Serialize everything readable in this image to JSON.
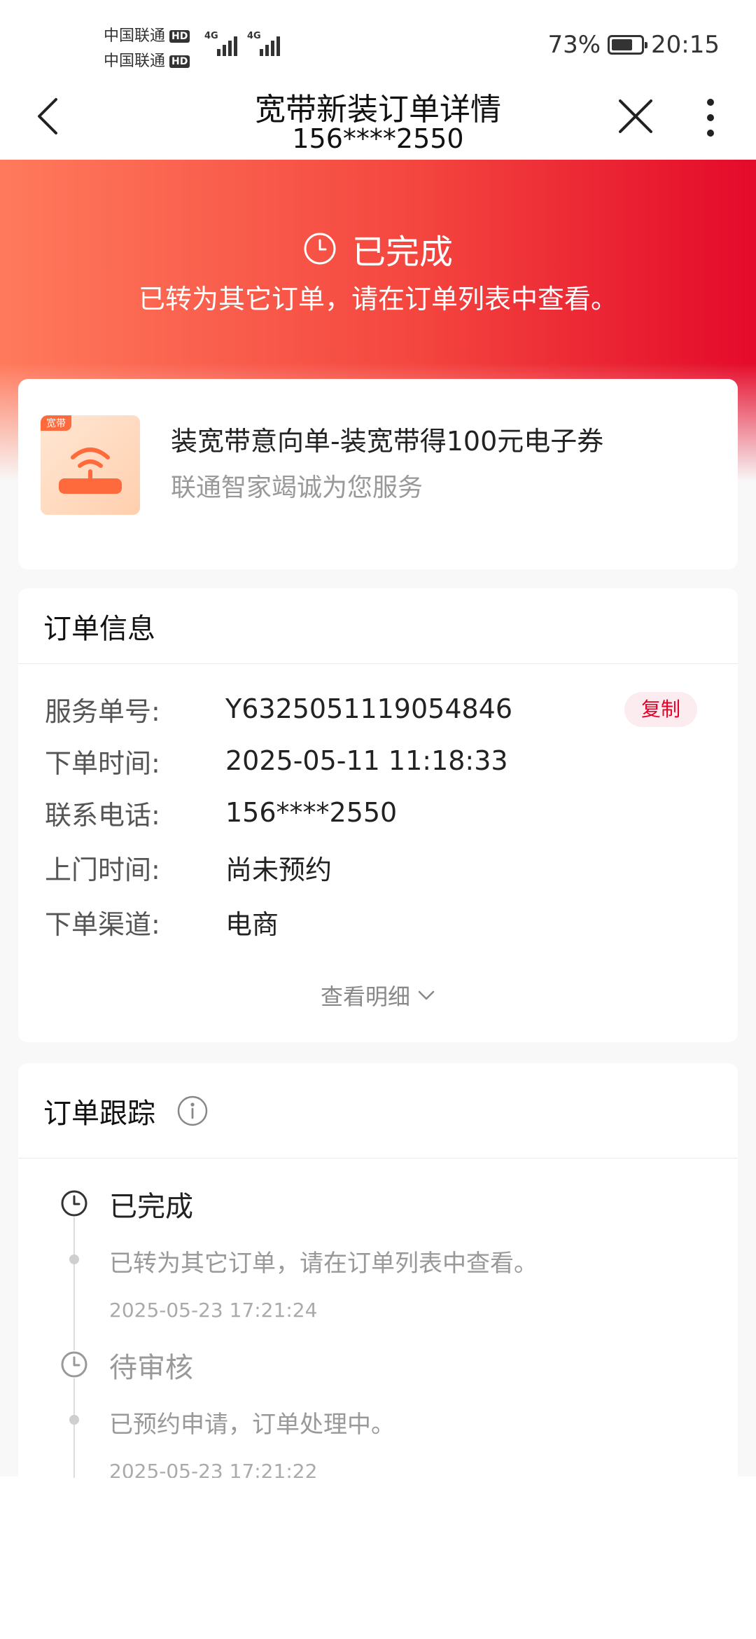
{
  "status_bar": {
    "carrier1": "中国联通",
    "carrier2": "中国联通",
    "hd_label": "HD",
    "net_label": "4G",
    "battery_percent": "73%",
    "battery_level": 0.73,
    "time": "20:15"
  },
  "nav": {
    "title": "宽带新装订单详情",
    "subtitle": "156****2550",
    "back_icon": "chevron-left-icon",
    "close_icon": "close-icon",
    "more_icon": "more-vertical-icon"
  },
  "hero": {
    "status": "已完成",
    "description": "已转为其它订单，请在订单列表中查看。",
    "icon": "clock-icon"
  },
  "product": {
    "tag": "宽带",
    "title": "装宽带意向单-装宽带得100元电子券",
    "subtitle": "联通智家竭诚为您服务",
    "icon": "router-icon"
  },
  "order_info": {
    "heading": "订单信息",
    "rows": [
      {
        "label": "服务单号:",
        "value": "Y6325051119054846"
      },
      {
        "label": "下单时间:",
        "value": "2025-05-11 11:18:33"
      },
      {
        "label": "联系电话:",
        "value": "156****2550"
      },
      {
        "label": "上门时间:",
        "value": "尚未预约"
      },
      {
        "label": "下单渠道:",
        "value": "电商"
      }
    ],
    "copy_label": "复制",
    "detail_link": "查看明细"
  },
  "tracking": {
    "heading": "订单跟踪",
    "events": [
      {
        "status": "已完成",
        "description": "已转为其它订单，请在订单列表中查看。",
        "time": "2025-05-23 17:21:24"
      },
      {
        "status": "待审核",
        "description": "已预约申请，订单处理中。",
        "time": "2025-05-23 17:21:22"
      }
    ]
  },
  "colors": {
    "brand_red": "#e60027",
    "hero_gradient_start": "#ff7a5c",
    "hero_gradient_end": "#e40a2a"
  }
}
